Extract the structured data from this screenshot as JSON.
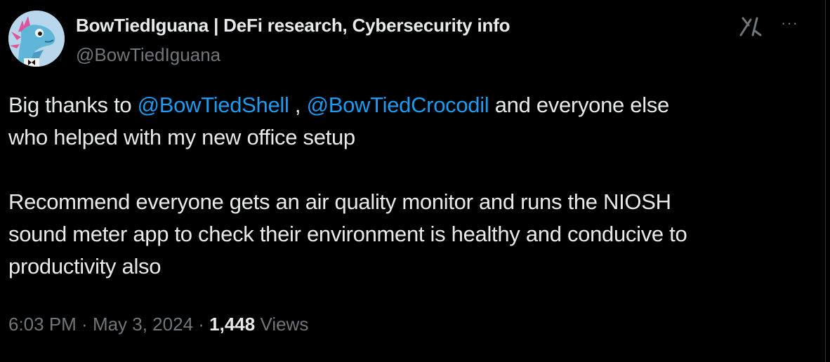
{
  "tweet": {
    "author_name": "BowTiedIguana | DeFi research, Cybersecurity info",
    "author_handle": "@BowTiedIguana",
    "more_label": "···",
    "body": {
      "line1_pre": "Big thanks to ",
      "mention1": "@BowTiedShell",
      "line1_mid": " , ",
      "mention2": "@BowTiedCrocodil",
      "line1_post": " and everyone else",
      "line2": "who helped with my new office setup",
      "line3": "Recommend everyone gets an air quality monitor and runs the NIOSH",
      "line4": "sound meter app to check their environment is healthy and conducive to",
      "line5": "productivity also"
    },
    "meta": {
      "time": "6:03 PM",
      "sep1": " · ",
      "date": "May 3, 2024",
      "sep2": " · ",
      "views_count": "1,448",
      "views_label": " Views"
    }
  },
  "colors": {
    "background": "#000000",
    "text": "#e7e9ea",
    "muted": "#71767b",
    "link": "#1d9bf0"
  },
  "icons": {
    "grok": "grok-icon",
    "more": "more-icon",
    "avatar": "iguana-avatar"
  }
}
